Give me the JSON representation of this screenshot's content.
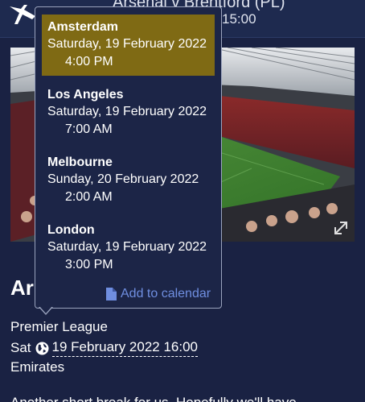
{
  "header": {
    "title": "Arsenal v Brentford (PL)",
    "time": "15:00"
  },
  "timezones": [
    {
      "city": "Amsterdam",
      "date": "Saturday, 19 February 2022",
      "time": "4:00 PM",
      "selected": true
    },
    {
      "city": "Los Angeles",
      "date": "Saturday, 19 February 2022",
      "time": "7:00 AM",
      "selected": false
    },
    {
      "city": "Melbourne",
      "date": "Sunday, 20 February 2022",
      "time": "2:00 AM",
      "selected": false
    },
    {
      "city": "London",
      "date": "Saturday, 19 February 2022",
      "time": "3:00 PM",
      "selected": false
    }
  ],
  "add_to_calendar": "Add to calendar",
  "article": {
    "title": "Ar",
    "league": "Premier League",
    "day": "Sat",
    "datetime": "19 February 2022 16:00",
    "venue": "Emirates",
    "body_preview": "Another short break for us. Hopefully we'll have"
  },
  "icons": {
    "logo": "cannon-logo",
    "globe": "globe-icon",
    "calendar": "document-icon",
    "expand": "expand-icon"
  },
  "colors": {
    "background": "#1a2243",
    "selected": "#7f6a14",
    "link": "#6f8ee0",
    "popover_border": "#9aa3bd"
  }
}
